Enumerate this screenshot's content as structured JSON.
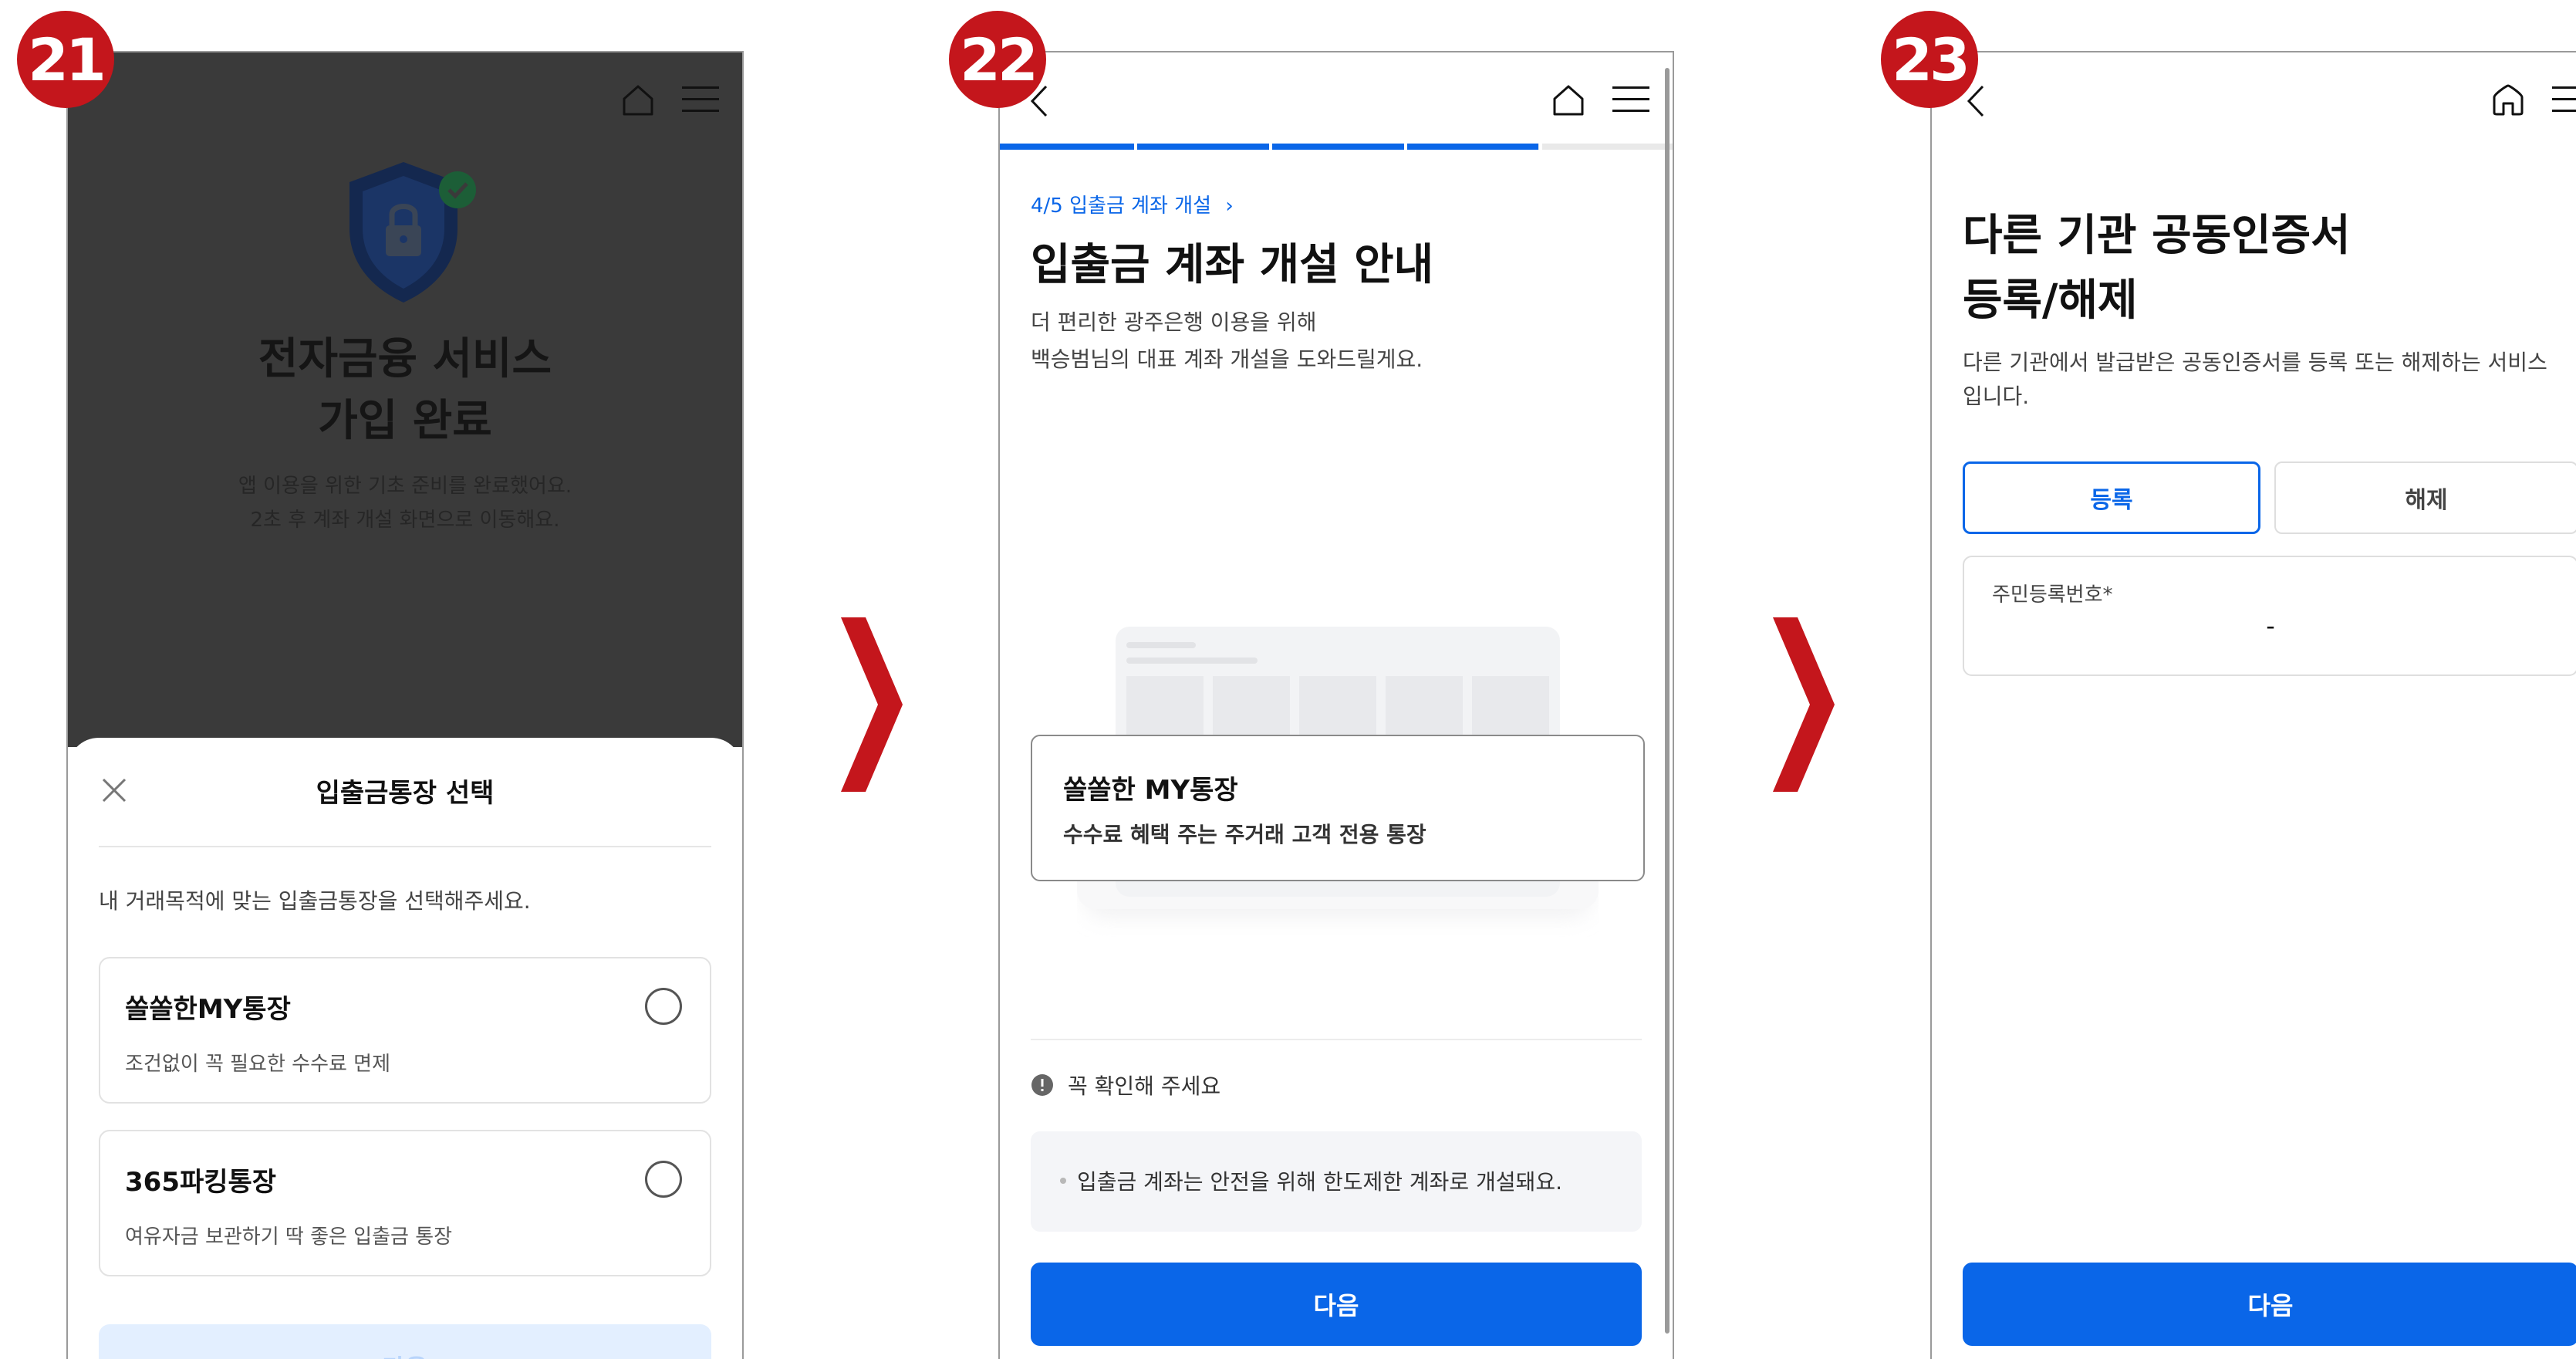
{
  "badges": {
    "s21": "21",
    "s22": "22",
    "s23": "23"
  },
  "screen21": {
    "title_line1": "전자금융 서비스",
    "title_line2": "가입 완료",
    "sub_line1": "앱 이용을 위한 기초 준비를 완료했어요.",
    "sub_line2": "2초 후 계좌 개설 화면으로 이동해요.",
    "sheet": {
      "title": "입출금통장 선택",
      "description": "내 거래목적에 맞는 입출금통장을 선택해주세요.",
      "options": [
        {
          "name": "쏠쏠한MY통장",
          "desc": "조건없이 꼭 필요한 수수료 면제"
        },
        {
          "name": "365파킹통장",
          "desc": "여유자금 보관하기 딱 좋은 입출금 통장"
        }
      ],
      "next_label": "다음"
    }
  },
  "screen22": {
    "breadcrumb": "4/5 입출금 계좌 개설",
    "title": "입출금 계좌 개설 안내",
    "sub_line1": "더 편리한 광주은행 이용을 위해",
    "sub_line2": "백승범님의 대표 계좌 개설을 도와드릴게요.",
    "progress": 0.8,
    "card_name": "쏠쏠한 MY통장",
    "card_desc": "수수료 혜택 주는 주거래 고객 전용 통장",
    "notice_head": "꼭 확인해 주세요",
    "notice_item": "입출금 계좌는 안전을 위해 한도제한 계좌로 개설돼요.",
    "next_label": "다음"
  },
  "screen23": {
    "title_line1": "다른 기관 공동인증서",
    "title_line2": "등록/해제",
    "sub": "다른 기관에서 발급받은 공동인증서를 등록 또는 해제하는 서비스입니다.",
    "seg_register": "등록",
    "seg_unregister": "해제",
    "field_label": "주민등록번호*",
    "field_dash": "-",
    "next_label": "다음"
  },
  "colors": {
    "badge": "#c4161c",
    "primary": "#0a66e8",
    "arrow": "#c4161c"
  }
}
